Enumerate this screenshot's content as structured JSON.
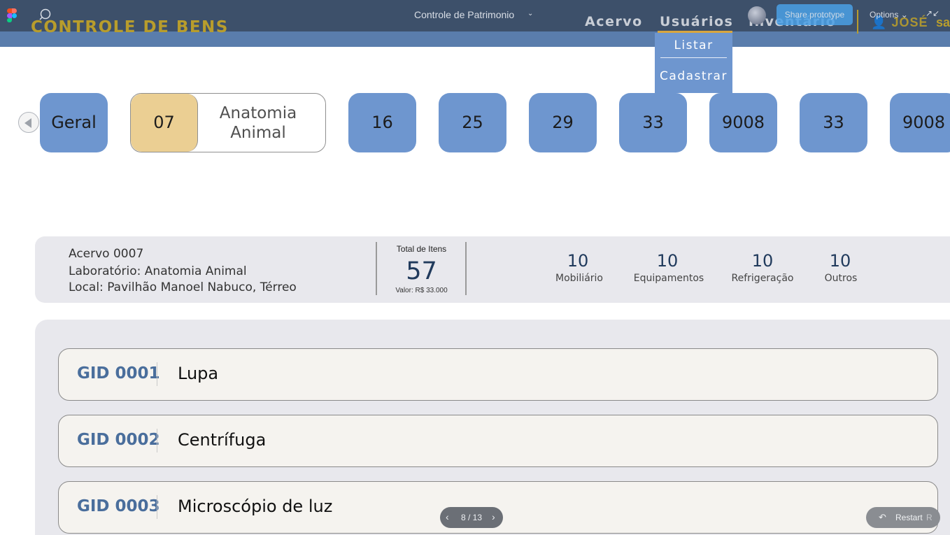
{
  "figma": {
    "file_title": "Controle de Patrimonio",
    "share_label": "Share prototype",
    "options_label": "Options",
    "pager_text": "8 / 13",
    "restart_label": "Restart",
    "restart_key": "R"
  },
  "app": {
    "title": "CONTROLE DE BENS",
    "nav": [
      "Acervo",
      "Usuários",
      "Inventário"
    ],
    "active_nav": "Usuários",
    "user_name": "JOSÉ",
    "user_trail": "sa"
  },
  "dropdown": {
    "items": [
      "Listar",
      "Cadastrar"
    ]
  },
  "tiles": {
    "general": "Geral",
    "selected": {
      "number": "07",
      "name_line1": "Anatomia",
      "name_line2": "Animal"
    },
    "others": [
      "16",
      "25",
      "29",
      "33",
      "9008",
      "33",
      "9008"
    ]
  },
  "info": {
    "acervo": "Acervo 0007",
    "laboratorio": "Laboratório: Anatomia Animal",
    "local": "Local: Pavilhão Manoel Nabuco, Térreo",
    "total_label": "Total de Itens",
    "total_value": "57",
    "valor": "Valor: R$ 33.000",
    "categories": [
      {
        "count": "10",
        "label": "Mobiliário"
      },
      {
        "count": "10",
        "label": "Equipamentos"
      },
      {
        "count": "10",
        "label": "Refrigeração"
      },
      {
        "count": "10",
        "label": "Outros"
      }
    ]
  },
  "items": [
    {
      "gid": "GID 0001",
      "name": "Lupa"
    },
    {
      "gid": "GID 0002",
      "name": "Centrífuga"
    },
    {
      "gid": "GID 0003",
      "name": "Microscópio de luz"
    }
  ],
  "colors": {
    "figma_bar": "#3d506a",
    "brand_gold": "#b89d2c",
    "tile_blue": "#6e96cf",
    "selected_tile": "#ebcf93",
    "gid_blue": "#4a6e9c"
  }
}
